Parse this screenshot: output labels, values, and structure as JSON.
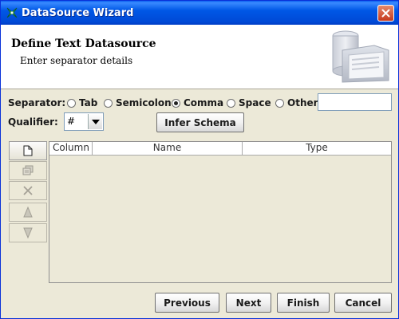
{
  "window": {
    "title": "DataSource Wizard"
  },
  "header": {
    "title": "Define Text Datasource",
    "subtitle": "Enter separator details"
  },
  "separator": {
    "label": "Separator:",
    "options": [
      {
        "label": "Tab",
        "selected": false
      },
      {
        "label": "Semicolon",
        "selected": false
      },
      {
        "label": "Comma",
        "selected": true
      },
      {
        "label": "Space",
        "selected": false
      },
      {
        "label": "Other",
        "selected": false
      }
    ],
    "other_value": ""
  },
  "qualifier": {
    "label": "Qualifier:",
    "value": "#"
  },
  "infer_schema_label": "Infer Schema",
  "toolbar": {
    "items": [
      {
        "icon": "new-document-icon",
        "enabled": true
      },
      {
        "icon": "copy-icon",
        "enabled": false
      },
      {
        "icon": "delete-icon",
        "enabled": false
      },
      {
        "icon": "move-up-icon",
        "enabled": false
      },
      {
        "icon": "move-down-icon",
        "enabled": false
      }
    ]
  },
  "table": {
    "columns": [
      "Column",
      "Name",
      "Type"
    ],
    "rows": []
  },
  "footer": {
    "previous": "Previous",
    "next": "Next",
    "finish": "Finish",
    "cancel": "Cancel"
  },
  "colors": {
    "titlebar": "#0058E6",
    "window_bg": "#ECE9D8",
    "close": "#C6391C"
  }
}
